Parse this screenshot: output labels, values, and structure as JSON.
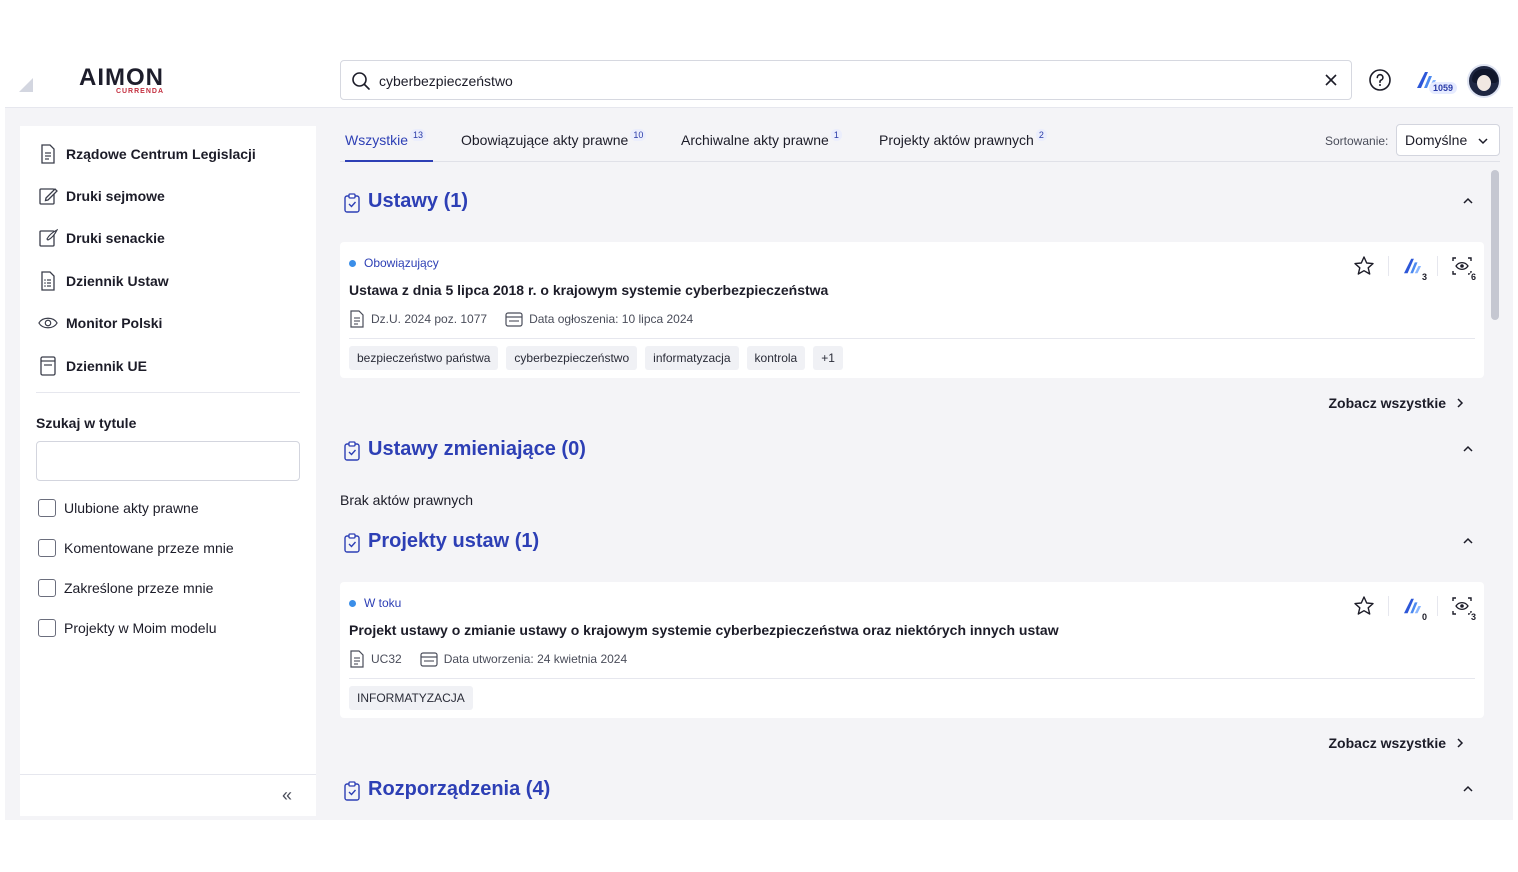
{
  "header": {
    "logo_main": "AIMON",
    "logo_sub": "CURRENDA",
    "search_value": "cyberbezpieczeństwo",
    "ai_count": "1059"
  },
  "sidebar": {
    "items": [
      {
        "label": "Rządowe Centrum Legislacji",
        "icon": "document-icon"
      },
      {
        "label": "Druki sejmowe",
        "icon": "edit-icon"
      },
      {
        "label": "Druki senackie",
        "icon": "pen-icon"
      },
      {
        "label": "Dziennik Ustaw",
        "icon": "list-document-icon"
      },
      {
        "label": "Monitor Polski",
        "icon": "eye-icon"
      },
      {
        "label": "Dziennik UE",
        "icon": "book-icon"
      }
    ],
    "search_title_label": "Szukaj w tytule",
    "search_title_value": "",
    "checkboxes": [
      {
        "label": "Ulubione akty prawne",
        "checked": false
      },
      {
        "label": "Komentowane przeze mnie",
        "checked": false
      },
      {
        "label": "Zakreślone przeze mnie",
        "checked": false
      },
      {
        "label": "Projekty w Moim modelu",
        "checked": false
      }
    ],
    "collapse_label": "«"
  },
  "tabs": [
    {
      "label": "Wszystkie",
      "count": "13",
      "active": true
    },
    {
      "label": "Obowiązujące akty prawne",
      "count": "10",
      "active": false
    },
    {
      "label": "Archiwalne akty prawne",
      "count": "1",
      "active": false
    },
    {
      "label": "Projekty aktów prawnych",
      "count": "2",
      "active": false
    }
  ],
  "sort": {
    "label": "Sortowanie:",
    "value": "Domyślne"
  },
  "sections": [
    {
      "title": "Ustawy (1)",
      "card": {
        "status": "Obowiązujący",
        "title": "Ustawa z dnia 5 lipca 2018 r. o krajowym systemie cyberbezpieczeństwa",
        "meta1": "Dz.U. 2024 poz. 1077",
        "meta2": "Data ogłoszenia: 10 lipca 2024",
        "tags": [
          "bezpieczeństwo państwa",
          "cyberbezpieczeństwo",
          "informatyzacja",
          "kontrola",
          "+1"
        ],
        "ai_count": "3",
        "watch_count": "6"
      },
      "see_all": "Zobacz wszystkie"
    },
    {
      "title": "Ustawy zmieniające (0)",
      "empty": "Brak aktów prawnych"
    },
    {
      "title": "Projekty ustaw (1)",
      "card": {
        "status": "W toku",
        "title": "Projekt ustawy o zmianie ustawy o krajowym systemie cyberbezpieczeństwa oraz niektórych innych ustaw",
        "meta1": "UC32",
        "meta2": "Data utworzenia: 24 kwietnia 2024",
        "tags": [
          "INFORMATYZACJA"
        ],
        "ai_count": "0",
        "watch_count": "3"
      },
      "see_all": "Zobacz wszystkie"
    },
    {
      "title": "Rozporządzenia (4)"
    }
  ],
  "colors": {
    "accent": "#2d3fb5",
    "status_dot": "#3b8ee8",
    "logo_red": "#c43040"
  }
}
